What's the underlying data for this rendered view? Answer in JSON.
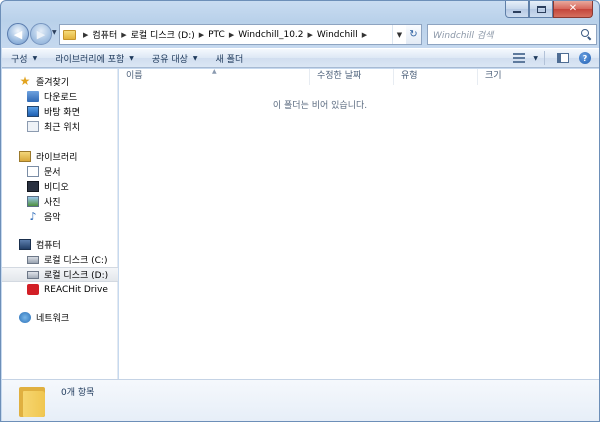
{
  "address": {
    "crumbs": [
      "컴퓨터",
      "로컬 디스크 (D:)",
      "PTC",
      "Windchill_10.2",
      "Windchill"
    ]
  },
  "search": {
    "placeholder": "Windchill 검색"
  },
  "commandbar": {
    "organize": "구성",
    "include_in_library": "라이브러리에 포함",
    "share_with": "공유 대상",
    "new_folder": "새 폴더"
  },
  "navigation": {
    "favorites": {
      "label": "즐겨찾기",
      "items": [
        "다운로드",
        "바탕 화면",
        "최근 위치"
      ]
    },
    "libraries": {
      "label": "라이브러리",
      "items": [
        "문서",
        "비디오",
        "사진",
        "음악"
      ]
    },
    "computer": {
      "label": "컴퓨터",
      "items": [
        "로컬 디스크 (C:)",
        "로컬 디스크 (D:)",
        "REACHit Drive"
      ],
      "selected": "로컬 디스크 (D:)"
    },
    "network": {
      "label": "네트워크"
    }
  },
  "columns": [
    "이름",
    "수정한 날짜",
    "유형",
    "크기"
  ],
  "empty_message": "이 폴더는 비어 있습니다.",
  "details": {
    "item_count": "0개 항목"
  },
  "colors": {
    "frame": "#b9d1ea",
    "selection": "#e3e7ec",
    "reachit": "#d21f26"
  }
}
